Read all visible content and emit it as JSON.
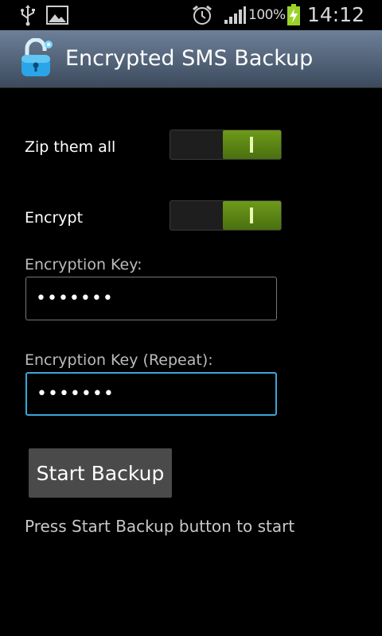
{
  "status_bar": {
    "battery_percent": "100%",
    "time": "14:12",
    "icons": [
      "usb-icon",
      "gallery-icon",
      "alarm-icon",
      "signal-icon",
      "battery-charging-icon"
    ]
  },
  "app": {
    "title": "Encrypted SMS Backup",
    "icon": "unlocked-padlock-icon"
  },
  "settings": {
    "zip": {
      "label": "Zip them all",
      "state": "on"
    },
    "encrypt": {
      "label": "Encrypt",
      "state": "on"
    }
  },
  "fields": {
    "key": {
      "label": "Encryption Key:",
      "value": "•••••••"
    },
    "key_repeat": {
      "label": "Encryption Key (Repeat):",
      "value": "•••••••"
    }
  },
  "actions": {
    "start_label": "Start Backup"
  },
  "status": {
    "message": "Press Start Backup button to start"
  },
  "colors": {
    "switch_on": "#5a8614",
    "focus": "#3aa6d6",
    "actionbar": "#53657c"
  }
}
